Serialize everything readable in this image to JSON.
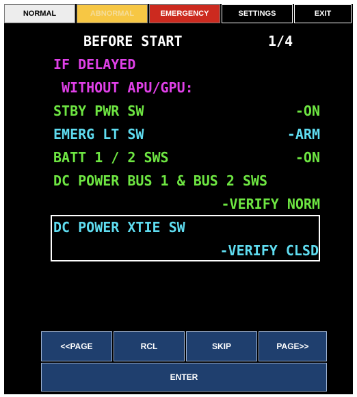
{
  "tabs": {
    "normal": "NORMAL",
    "abnormal": "ABNORMAL",
    "emergency": "EMERGENCY",
    "settings": "SETTINGS",
    "exit": "EXIT"
  },
  "checklist": {
    "title": "BEFORE START",
    "page": "1/4",
    "condition_1": "IF DELAYED",
    "condition_2": "WITHOUT APU/GPU:",
    "items": [
      {
        "label": "STBY PWR SW",
        "action": "-ON"
      },
      {
        "label": "EMERG LT SW",
        "action": "-ARM"
      },
      {
        "label": "BATT 1 / 2 SWS",
        "action": "-ON"
      },
      {
        "label": "DC POWER BUS 1 & BUS 2 SWS",
        "action": "-VERIFY NORM"
      },
      {
        "label": "DC POWER XTIE SW",
        "action": "-VERIFY CLSD"
      }
    ]
  },
  "buttons": {
    "prev_page": "<<PAGE",
    "recall": "RCL",
    "skip": "SKIP",
    "next_page": "PAGE>>",
    "enter": "ENTER"
  },
  "colors": {
    "header": "#ffffff",
    "condition": "#e040e8",
    "item_normal": "#6ee642",
    "item_cyan": "#5fdcf0",
    "button_bg": "#1f3f6e",
    "abnormal_tab": "#f7c744",
    "emergency_tab": "#cc2a1f"
  }
}
